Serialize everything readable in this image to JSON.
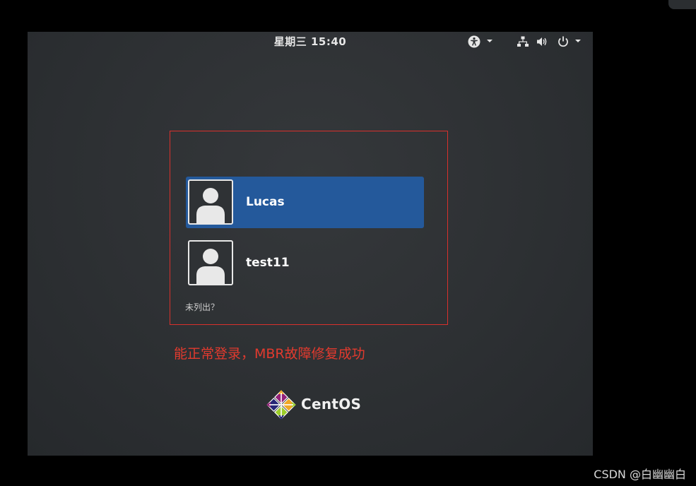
{
  "topbar": {
    "clock": "星期三 15:40",
    "icons": [
      "accessibility-icon",
      "chevron-down-icon",
      "network-icon",
      "volume-icon",
      "power-icon",
      "chevron-down-icon"
    ]
  },
  "users": [
    {
      "name": "Lucas",
      "selected": true
    },
    {
      "name": "test11",
      "selected": false
    }
  ],
  "not_listed_label": "未列出？",
  "annotation": "能正常登录，MBR故障修复成功",
  "logo": {
    "text": "CentOS"
  },
  "watermark": "CSDN @白幽幽白",
  "colors": {
    "selected_row": "#24599b",
    "annotation_red": "#e23a2e",
    "background": "#2d3033"
  }
}
